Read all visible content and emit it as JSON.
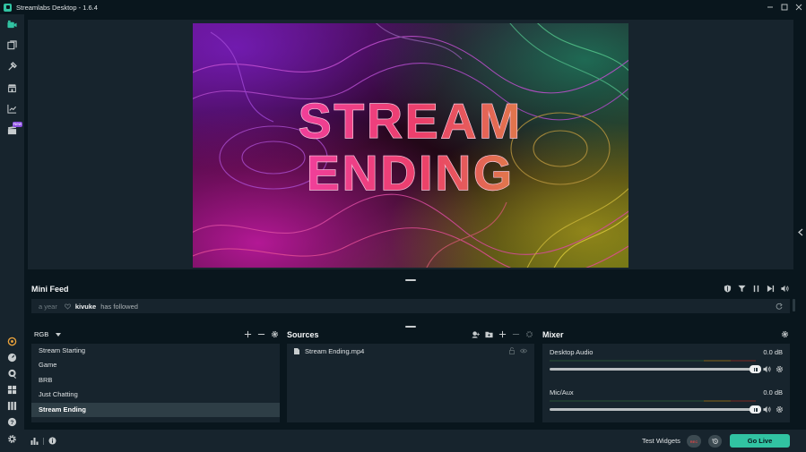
{
  "window": {
    "title": "Streamlabs Desktop - 1.6.4",
    "minimize_icon": "minimize-icon",
    "maximize_icon": "maximize-icon",
    "close_icon": "close-icon"
  },
  "sidebar": {
    "items": [
      {
        "icon": "editor-icon",
        "active": true
      },
      {
        "icon": "themes-icon"
      },
      {
        "icon": "app-store-icon"
      },
      {
        "icon": "store-icon"
      },
      {
        "icon": "dashboard-icon"
      },
      {
        "icon": "highlighter-icon",
        "badge": "New"
      }
    ],
    "bottom_items": [
      {
        "icon": "prime-icon"
      },
      {
        "icon": "dashboard-link-icon"
      },
      {
        "icon": "chat-icon"
      },
      {
        "icon": "layout-icon"
      },
      {
        "icon": "studio-mode-icon"
      },
      {
        "icon": "help-icon"
      },
      {
        "icon": "settings-icon"
      }
    ]
  },
  "preview": {
    "line1": "STREAM",
    "line2": "ENDING"
  },
  "mini_feed": {
    "title": "Mini Feed",
    "tools": [
      "filter-shield-icon",
      "filter-icon",
      "pause-icon",
      "skip-icon",
      "volume-icon"
    ],
    "events": [
      {
        "time": "a year",
        "user": "kivuke",
        "action": "has followed"
      }
    ]
  },
  "scenes": {
    "collection": "RGB",
    "items": [
      "Stream Starting",
      "Game",
      "BRB",
      "Just Chatting",
      "Stream Ending"
    ],
    "active_index": 4
  },
  "sources": {
    "title": "Sources",
    "items": [
      {
        "name": "Stream Ending.mp4"
      }
    ]
  },
  "mixer": {
    "title": "Mixer",
    "channels": [
      {
        "name": "Desktop Audio",
        "db": "0.0 dB",
        "level": 1.0
      },
      {
        "name": "Mic/Aux",
        "db": "0.0 dB",
        "level": 1.0
      }
    ]
  },
  "footer": {
    "test_widgets": "Test Widgets",
    "rec_label": "REC",
    "go_live": "Go Live"
  },
  "colors": {
    "accent": "#31c3a2",
    "background": "#09161d",
    "panel": "#17242d"
  }
}
